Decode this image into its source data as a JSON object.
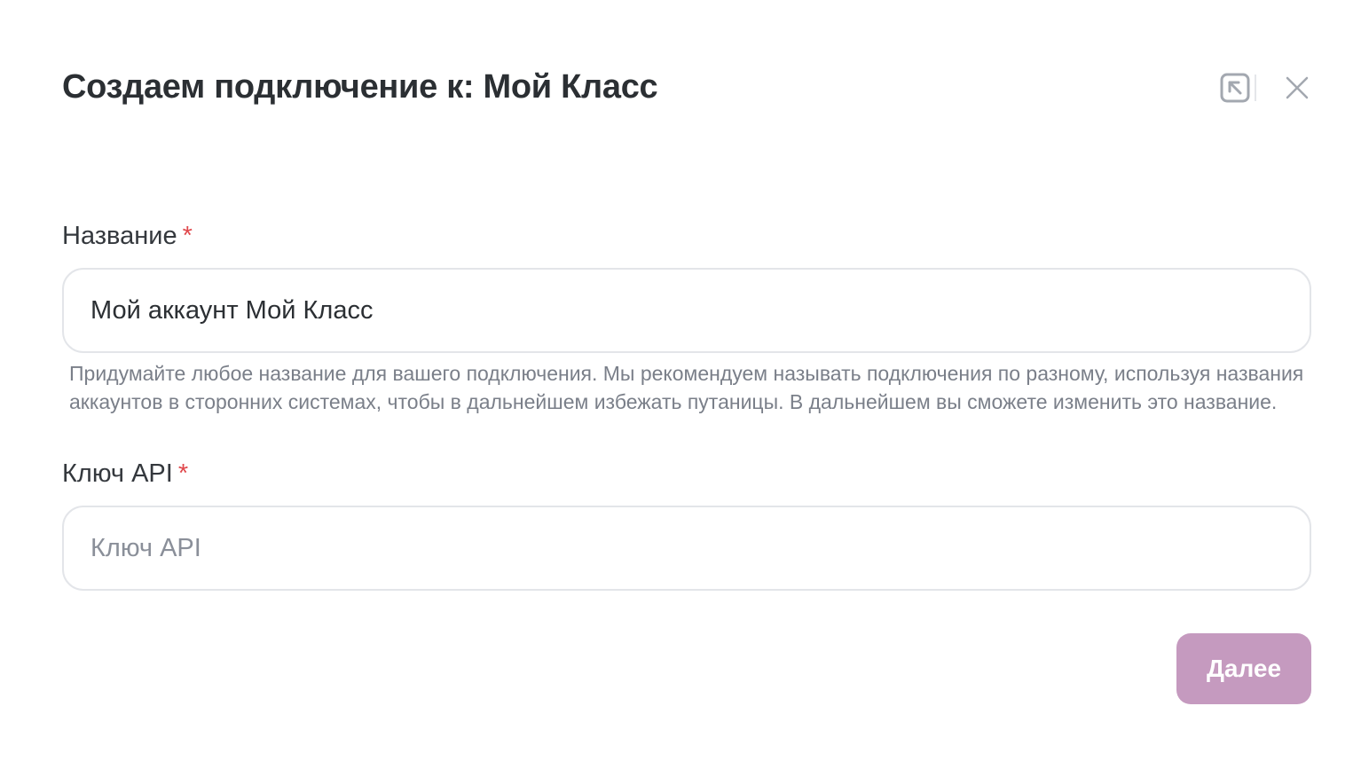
{
  "header": {
    "title": "Создаем подключение к: Мой Класс",
    "open_icon": "open-in-window-icon",
    "close_icon": "close-icon"
  },
  "form": {
    "name_field": {
      "label": "Название",
      "required_mark": "*",
      "value": "Мой аккаунт Мой Класс",
      "hint": "Придумайте любое название для вашего подключения. Мы рекомендуем называть подключения по разному, используя названия аккаунтов в сторонних системах, чтобы в дальнейшем избежать путаницы. В дальнейшем вы сможете изменить это название."
    },
    "api_key_field": {
      "label": "Ключ API",
      "required_mark": "*",
      "value": "",
      "placeholder": "Ключ API"
    }
  },
  "actions": {
    "next_label": "Далее"
  },
  "colors": {
    "accent": "#c59abf",
    "required": "#e0484c",
    "title": "#2b2f33",
    "border": "#e3e5e9"
  }
}
